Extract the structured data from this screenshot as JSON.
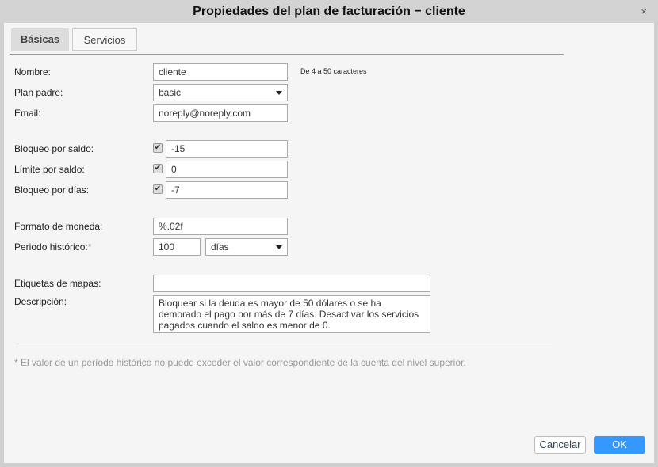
{
  "title": "Propiedades del plan de facturación − cliente",
  "close_icon": "×",
  "tabs": [
    {
      "label": "Básicas"
    },
    {
      "label": "Servicios"
    }
  ],
  "fields": {
    "nombre": {
      "label": "Nombre:",
      "value": "cliente",
      "hint": "De 4 a 50 caracteres"
    },
    "plan_padre": {
      "label": "Plan padre:",
      "value": "basic"
    },
    "email": {
      "label": "Email:",
      "value": "noreply@noreply.com"
    },
    "bloqueo_saldo": {
      "label": "Bloqueo por saldo:",
      "checked": true,
      "value": "-15"
    },
    "limite_saldo": {
      "label": "Límite por saldo:",
      "checked": true,
      "value": "0"
    },
    "bloqueo_dias": {
      "label": "Bloqueo por días:",
      "checked": true,
      "value": "-7"
    },
    "formato_moneda": {
      "label": "Formato de moneda:",
      "value": "%.02f"
    },
    "periodo": {
      "label": "Periodo histórico:",
      "required": "*",
      "value": "100",
      "unit": "días"
    },
    "etiquetas": {
      "label": "Etiquetas de mapas:",
      "value": ""
    },
    "descripcion": {
      "label": "Descripción:",
      "value": "Bloquear si la deuda es mayor de 50 dólares o se ha demorado el pago por más de 7 días. Desactivar los servicios pagados cuando el saldo es menor de 0."
    }
  },
  "note": "* El valor de un período histórico no puede exceder el valor correspondiente de la cuenta del nivel superior.",
  "buttons": {
    "cancel": "Cancelar",
    "ok": "OK"
  },
  "check_mark": "✔"
}
